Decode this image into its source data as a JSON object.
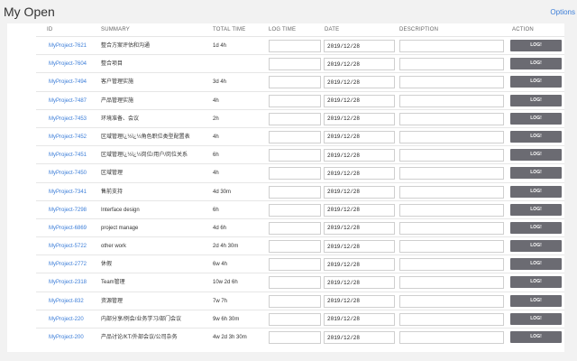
{
  "header": {
    "title": "My Open",
    "options_label": "Options"
  },
  "columns": {
    "id": "ID",
    "summary": "SUMMARY",
    "total": "TOTAL TIME",
    "log": "LOG TIME",
    "date": "DATE",
    "desc": "DESCRIPTION",
    "action": "ACTION"
  },
  "rows": [
    {
      "id": "MyProject-7621",
      "summary": "整合方案评估和沟通",
      "total": "1d 4h",
      "log": "",
      "date": "2019/12/28",
      "desc": "",
      "btn": "LOG!"
    },
    {
      "id": "MyProject-7604",
      "summary": "整合项目",
      "total": "",
      "log": "",
      "date": "2019/12/28",
      "desc": "",
      "btn": "LOG!"
    },
    {
      "id": "MyProject-7494",
      "summary": "客户管理实施",
      "total": "3d 4h",
      "log": "",
      "date": "2019/12/28",
      "desc": "",
      "btn": "LOG!"
    },
    {
      "id": "MyProject-7487",
      "summary": "产品管理实施",
      "total": "4h",
      "log": "",
      "date": "2019/12/28",
      "desc": "",
      "btn": "LOG!"
    },
    {
      "id": "MyProject-7453",
      "summary": "环境准备、会议",
      "total": "2h",
      "log": "",
      "date": "2019/12/28",
      "desc": "",
      "btn": "LOG!"
    },
    {
      "id": "MyProject-7452",
      "summary": "区域管理ï¿½ï¿½角色职位类型配置表",
      "total": "4h",
      "log": "",
      "date": "2019/12/28",
      "desc": "",
      "btn": "LOG!"
    },
    {
      "id": "MyProject-7451",
      "summary": "区域管理ï¿½ï¿½岗位/用户/岗位关系",
      "total": "6h",
      "log": "",
      "date": "2019/12/28",
      "desc": "",
      "btn": "LOG!"
    },
    {
      "id": "MyProject-7450",
      "summary": "区域管理",
      "total": "4h",
      "log": "",
      "date": "2019/12/28",
      "desc": "",
      "btn": "LOG!"
    },
    {
      "id": "MyProject-7341",
      "summary": "售前支持",
      "total": "4d 30m",
      "log": "",
      "date": "2019/12/28",
      "desc": "",
      "btn": "LOG!"
    },
    {
      "id": "MyProject-7298",
      "summary": "Interface design",
      "total": "6h",
      "log": "",
      "date": "2019/12/28",
      "desc": "",
      "btn": "LOG!"
    },
    {
      "id": "MyProject-6869",
      "summary": "project manage",
      "total": "4d 6h",
      "log": "",
      "date": "2019/12/28",
      "desc": "",
      "btn": "LOG!"
    },
    {
      "id": "MyProject-5722",
      "summary": "other work",
      "total": "2d 4h 30m",
      "log": "",
      "date": "2019/12/28",
      "desc": "",
      "btn": "LOG!"
    },
    {
      "id": "MyProject-2772",
      "summary": "休假",
      "total": "6w 4h",
      "log": "",
      "date": "2019/12/28",
      "desc": "",
      "btn": "LOG!"
    },
    {
      "id": "MyProject-2318",
      "summary": "Team管理",
      "total": "10w 2d 6h",
      "log": "",
      "date": "2019/12/28",
      "desc": "",
      "btn": "LOG!"
    },
    {
      "id": "MyProject-832",
      "summary": "资源管理",
      "total": "7w 7h",
      "log": "",
      "date": "2019/12/28",
      "desc": "",
      "btn": "LOG!"
    },
    {
      "id": "MyProject-220",
      "summary": "内部分享/例会/业务学习/部门会议",
      "total": "9w 6h 30m",
      "log": "",
      "date": "2019/12/28",
      "desc": "",
      "btn": "LOG!"
    },
    {
      "id": "MyProject-200",
      "summary": "产品讨论/KT/外部会议/公司杂务",
      "total": "4w 2d 3h 30m",
      "log": "",
      "date": "2019/12/28",
      "desc": "",
      "btn": "LOG!"
    }
  ]
}
